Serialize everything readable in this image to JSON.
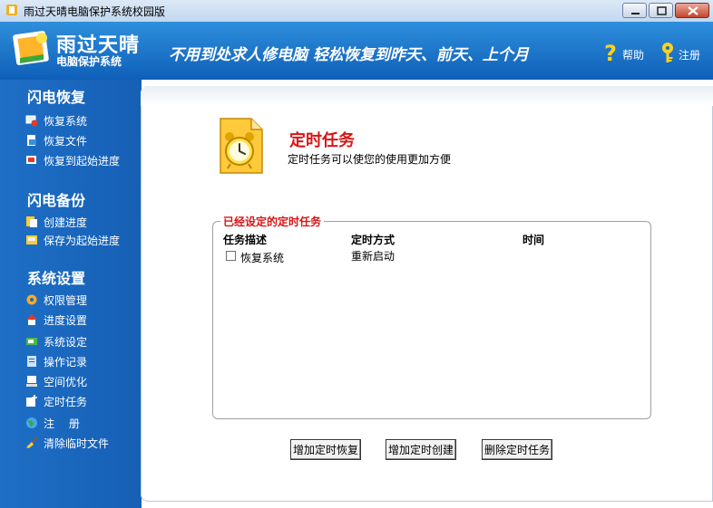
{
  "window": {
    "title": "雨过天晴电脑保护系统校园版"
  },
  "header": {
    "logo_main": "雨过天晴",
    "logo_sub": "电脑保护系统",
    "slogan": "不用到处求人修电脑 轻松恢复到昨天、前天、上个月",
    "help_label": "帮助",
    "register_label": "注册"
  },
  "sidebar": {
    "sections": [
      {
        "title": "闪电恢复",
        "items": [
          "恢复系统",
          "恢复文件",
          "恢复到起始进度"
        ]
      },
      {
        "title": "闪电备份",
        "items": [
          "创建进度",
          "保存为起始进度"
        ]
      },
      {
        "title": "系统设置",
        "items": [
          "权限管理",
          "进度设置",
          "系统设定",
          "操作记录",
          "空间优化",
          "定时任务",
          "注　 册",
          "清除临时文件"
        ]
      }
    ]
  },
  "main": {
    "title": "定时任务",
    "description": "定时任务可以使您的使用更加方便",
    "group_title": "已经设定的定时任务",
    "columns": [
      "任务描述",
      "定时方式",
      "时间"
    ],
    "rows": [
      {
        "checked": false,
        "description": "恢复系统",
        "mode": "重新启动",
        "time": ""
      }
    ],
    "buttons": [
      "增加定时恢复",
      "增加定时创建",
      "删除定时任务"
    ]
  },
  "colors": {
    "header_blue": "#1a72c9",
    "sidebar_blue": "#1b68bf",
    "accent_red": "#d81515"
  }
}
